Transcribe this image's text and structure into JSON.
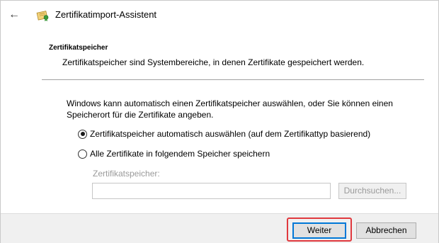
{
  "window": {
    "title": "Zertifikatimport-Assistent",
    "back_icon": "arrow-left-icon",
    "app_icon": "certificate-icon"
  },
  "section": {
    "heading": "Zertifikatspeicher",
    "description": "Zertifikatspeicher sind Systembereiche, in denen Zertifikate gespeichert werden."
  },
  "body": {
    "intro": "Windows kann automatisch einen Zertifikatspeicher auswählen, oder Sie können einen Speicherort für die Zertifikate angeben.",
    "options": [
      {
        "label": "Zertifikatspeicher automatisch auswählen (auf dem Zertifikattyp basierend)",
        "checked": true
      },
      {
        "label": "Alle Zertifikate in folgendem Speicher speichern",
        "checked": false
      }
    ],
    "store_label": "Zertifikatspeicher:",
    "store_value": "",
    "browse_label": "Durchsuchen..."
  },
  "footer": {
    "next_label": "Weiter",
    "cancel_label": "Abbrechen",
    "highlight_color": "#e0393e"
  }
}
